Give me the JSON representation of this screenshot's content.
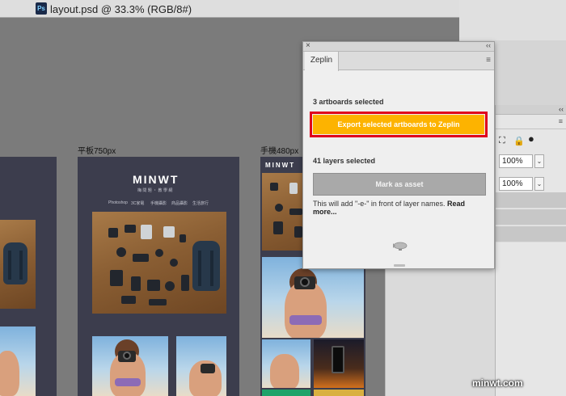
{
  "document": {
    "tab_title": "layout.psd @ 33.3% (RGB/8#)",
    "ps_icon_text": "Ps"
  },
  "canvas": {
    "artboards": [
      {
        "label": "平板750px",
        "logo": "MINWT",
        "tagline": "梅 問 題 ・ 教 學 網",
        "nav": [
          "Photoshop",
          "3C家電",
          "手機攝影",
          "商品攝影",
          "生活旅行"
        ]
      },
      {
        "label": "手機480px",
        "logo": "MINWT"
      }
    ]
  },
  "zeplin_panel": {
    "tab_label": "Zeplin",
    "artboards_selected": "3 artboards selected",
    "export_button": "Export selected artboards to Zeplin",
    "layers_selected": "41 layers selected",
    "mark_button": "Mark as asset",
    "hint_text": "This will add \"-e-\" in front of layer names.",
    "read_more": "Read more..."
  },
  "side_panel": {
    "zoom_values": [
      "100%",
      "100%"
    ]
  },
  "watermark": "minwt.com",
  "colors": {
    "export_button": "#fdb300",
    "highlight_outline": "#e0001b",
    "artboard_bg": "#3c3d4d",
    "canvas_bg": "#7b7b7b"
  },
  "icons": {
    "transform": "transform-icon",
    "lock": "lock-icon",
    "fill": "fill-icon",
    "zeppelin": "zeppelin-icon"
  }
}
